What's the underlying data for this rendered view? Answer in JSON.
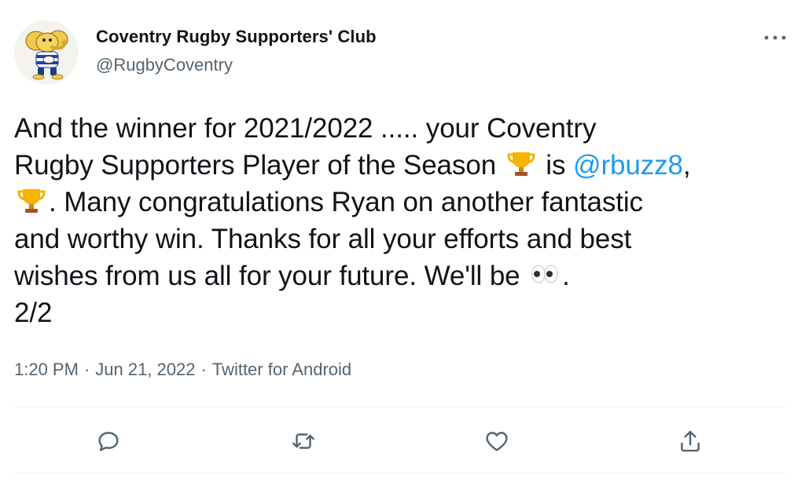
{
  "author": {
    "display_name": "Coventry Rugby Supporters' Club",
    "handle": "@RugbyCoventry"
  },
  "tweet": {
    "line1": "And the winner for 2021/2022 ..... your Coventry",
    "line2_before": "Rugby Supporters Player of the Season ",
    "line2_mid": " is ",
    "mention": "@rbuzz8",
    "line2_after": ",",
    "line3": ". Many congratulations Ryan on another fantastic",
    "line4": "and worthy win.  Thanks for all your efforts and best",
    "line5_before": "wishes from us all for your future. We'll be ",
    "line5_after": ".",
    "line6": "2/2"
  },
  "meta": {
    "time": "1:20 PM",
    "separator": "·",
    "date": "Jun 21, 2022",
    "source": "Twitter for Android"
  },
  "icons": {
    "avatar": "elephant-mascot",
    "more": "more-dots-icon",
    "reply": "reply-icon",
    "retweet": "retweet-icon",
    "like": "like-icon",
    "share": "share-icon",
    "trophy": "trophy-emoji",
    "eyes": "eyes-emoji"
  },
  "colors": {
    "link": "#1d9bf0",
    "secondary_text": "#536471",
    "primary_text": "#0f1419"
  }
}
